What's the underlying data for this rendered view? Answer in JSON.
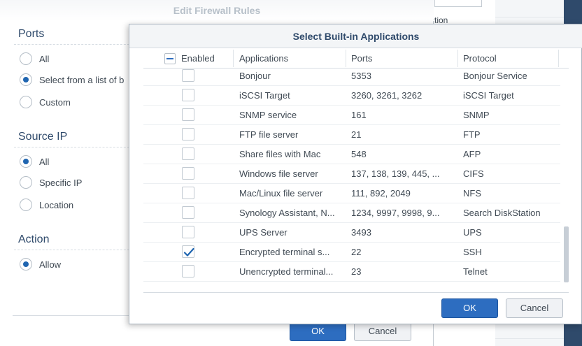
{
  "edit_dialog": {
    "title": "Edit Firewall Rules",
    "ports": {
      "heading": "Ports",
      "options": [
        {
          "label": "All",
          "checked": false
        },
        {
          "label": "Select from a list of b",
          "checked": true
        },
        {
          "label": "Custom",
          "checked": false
        }
      ]
    },
    "source_ip": {
      "heading": "Source IP",
      "options": [
        {
          "label": "All",
          "checked": true
        },
        {
          "label": "Specific IP",
          "checked": false
        },
        {
          "label": "Location",
          "checked": false
        }
      ]
    },
    "action": {
      "heading": "Action",
      "options": [
        {
          "label": "Allow",
          "checked": true
        }
      ]
    },
    "ok_label": "OK",
    "cancel_label": "Cancel"
  },
  "background": {
    "column_fragment": "ction"
  },
  "modal": {
    "title": "Select Built-in Applications",
    "columns": {
      "enabled": "Enabled",
      "applications": "Applications",
      "ports": "Ports",
      "protocol": "Protocol"
    },
    "rows": [
      {
        "app": "Bonjour",
        "ports": "5353",
        "protocol": "Bonjour Service",
        "checked": false
      },
      {
        "app": "iSCSI Target",
        "ports": "3260, 3261, 3262",
        "protocol": "iSCSI Target",
        "checked": false
      },
      {
        "app": "SNMP service",
        "ports": "161",
        "protocol": "SNMP",
        "checked": false
      },
      {
        "app": "FTP file server",
        "ports": "21",
        "protocol": "FTP",
        "checked": false
      },
      {
        "app": "Share files with Mac",
        "ports": "548",
        "protocol": "AFP",
        "checked": false
      },
      {
        "app": "Windows file server",
        "ports": "137, 138, 139, 445, ...",
        "protocol": "CIFS",
        "checked": false
      },
      {
        "app": "Mac/Linux file server",
        "ports": "111, 892, 2049",
        "protocol": "NFS",
        "checked": false
      },
      {
        "app": "Synology Assistant, N...",
        "ports": "1234, 9997, 9998, 9...",
        "protocol": "Search DiskStation",
        "checked": false
      },
      {
        "app": "UPS Server",
        "ports": "3493",
        "protocol": "UPS",
        "checked": false
      },
      {
        "app": "Encrypted terminal s...",
        "ports": "22",
        "protocol": "SSH",
        "checked": true
      },
      {
        "app": "Unencrypted terminal...",
        "ports": "23",
        "protocol": "Telnet",
        "checked": false
      }
    ],
    "ok_label": "OK",
    "cancel_label": "Cancel"
  },
  "colors": {
    "accent": "#2d6dc0",
    "heading": "#2f4a6b",
    "text": "#414b55"
  }
}
